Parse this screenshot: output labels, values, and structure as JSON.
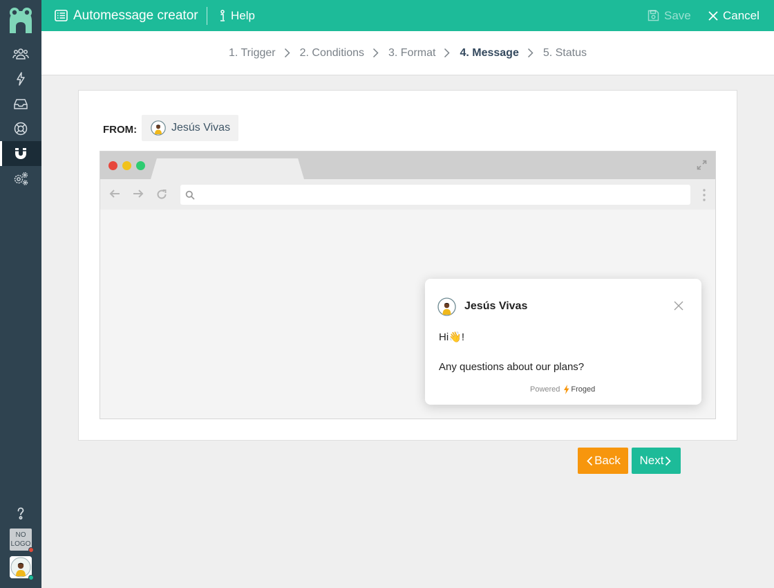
{
  "header": {
    "title": "Automessage creator",
    "help_label": "Help",
    "save_label": "Save",
    "cancel_label": "Cancel"
  },
  "steps": [
    {
      "label": "1. Trigger",
      "current": false
    },
    {
      "label": "2. Conditions",
      "current": false
    },
    {
      "label": "3. Format",
      "current": false
    },
    {
      "label": "4. Message",
      "current": true
    },
    {
      "label": "5. Status",
      "current": false
    }
  ],
  "from": {
    "label": "FROM:",
    "sender": "Jesús Vivas"
  },
  "preview": {
    "sender_name": "Jesús Vivas",
    "greeting": "Hi",
    "greeting_emoji": "👋",
    "greeting_suffix": "!",
    "body": "Any questions about our plans?",
    "powered_label": "Powered",
    "powered_brand": "Froged"
  },
  "sidebar": {
    "items": [
      "contacts-icon",
      "bolt-icon",
      "inbox-icon",
      "lifebuoy-icon",
      "magnet-icon",
      "settings-icon"
    ],
    "active_index": 4,
    "help_icon": "question-icon",
    "company_logo_text": "NO LOGO"
  },
  "buttons": {
    "back_label": "Back",
    "next_label": "Next"
  },
  "colors": {
    "primary": "#1dbb99",
    "sidebar": "#2f4350",
    "back_button": "#f7960d",
    "dot_red": "#e7473c",
    "dot_yellow": "#f1c21b",
    "dot_green": "#2ecc71"
  }
}
